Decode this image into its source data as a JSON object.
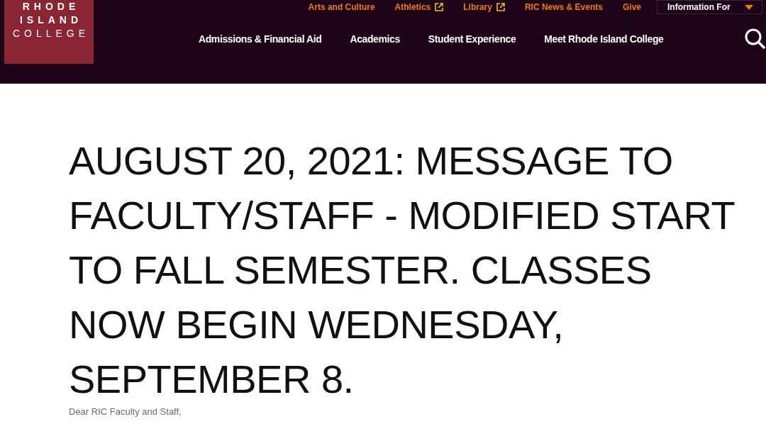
{
  "logo": {
    "lines": [
      "RHODE",
      "ISLAND",
      "COLLEGE"
    ]
  },
  "utility_links": [
    {
      "label": "Arts and Culture",
      "external": false
    },
    {
      "label": "Athletics",
      "external": true
    },
    {
      "label": "Library",
      "external": true
    },
    {
      "label": "RIC News & Events",
      "external": false
    },
    {
      "label": "Give",
      "external": false
    }
  ],
  "info_dropdown": {
    "label": "Information For"
  },
  "main_nav": [
    "Admissions & Financial Aid",
    "Academics",
    "Student Experience",
    "Meet Rhode Island College"
  ],
  "article": {
    "title": "AUGUST 20, 2021: MESSAGE TO FACULTY/STAFF - MODIFIED START TO FALL SEMESTER. CLASSES NOW BEGIN WEDNESDAY, SEPTEMBER 8.",
    "greeting": "Dear RIC Faculty and Staff,"
  }
}
